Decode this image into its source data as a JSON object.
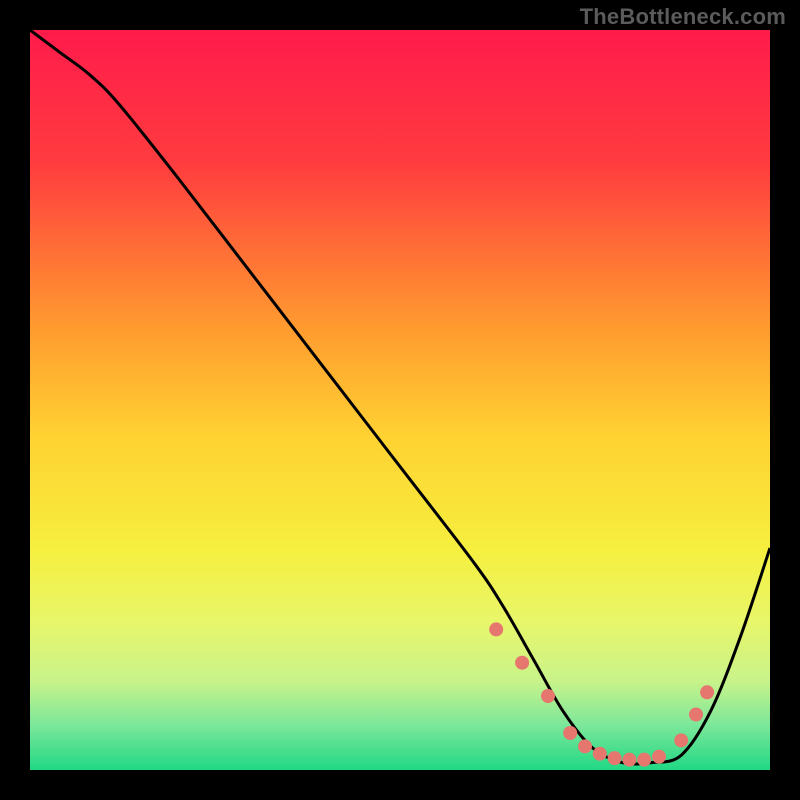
{
  "watermark": "TheBottleneck.com",
  "chart_data": {
    "type": "line",
    "title": "",
    "xlabel": "",
    "ylabel": "",
    "xlim": [
      0,
      100
    ],
    "ylim": [
      0,
      100
    ],
    "background_gradient": {
      "stops": [
        {
          "offset": 0,
          "color": "#ff1b4b"
        },
        {
          "offset": 18,
          "color": "#ff3c3f"
        },
        {
          "offset": 40,
          "color": "#ff9a2f"
        },
        {
          "offset": 55,
          "color": "#ffd232"
        },
        {
          "offset": 70,
          "color": "#f6ef3e"
        },
        {
          "offset": 80,
          "color": "#e8f66a"
        },
        {
          "offset": 88,
          "color": "#c8f38a"
        },
        {
          "offset": 94,
          "color": "#7be79a"
        },
        {
          "offset": 100,
          "color": "#20d884"
        }
      ]
    },
    "series": [
      {
        "name": "bottleneck-curve",
        "stroke": "#000000",
        "x": [
          0,
          4,
          8,
          12,
          20,
          30,
          40,
          50,
          60,
          64,
          68,
          72,
          76,
          80,
          84,
          88,
          92,
          96,
          100
        ],
        "values": [
          100,
          97,
          94,
          90,
          80,
          67,
          54,
          41,
          28,
          22,
          15,
          8,
          3,
          1,
          1,
          2,
          8,
          18,
          30
        ]
      }
    ],
    "markers": {
      "name": "highlight-points",
      "color": "#e6776f",
      "radius": 7,
      "x": [
        63,
        66.5,
        70,
        73,
        75,
        77,
        79,
        81,
        83,
        85,
        88,
        90,
        91.5
      ],
      "values": [
        19,
        14.5,
        10,
        5,
        3.2,
        2.2,
        1.6,
        1.4,
        1.4,
        1.8,
        4,
        7.5,
        10.5
      ]
    }
  }
}
